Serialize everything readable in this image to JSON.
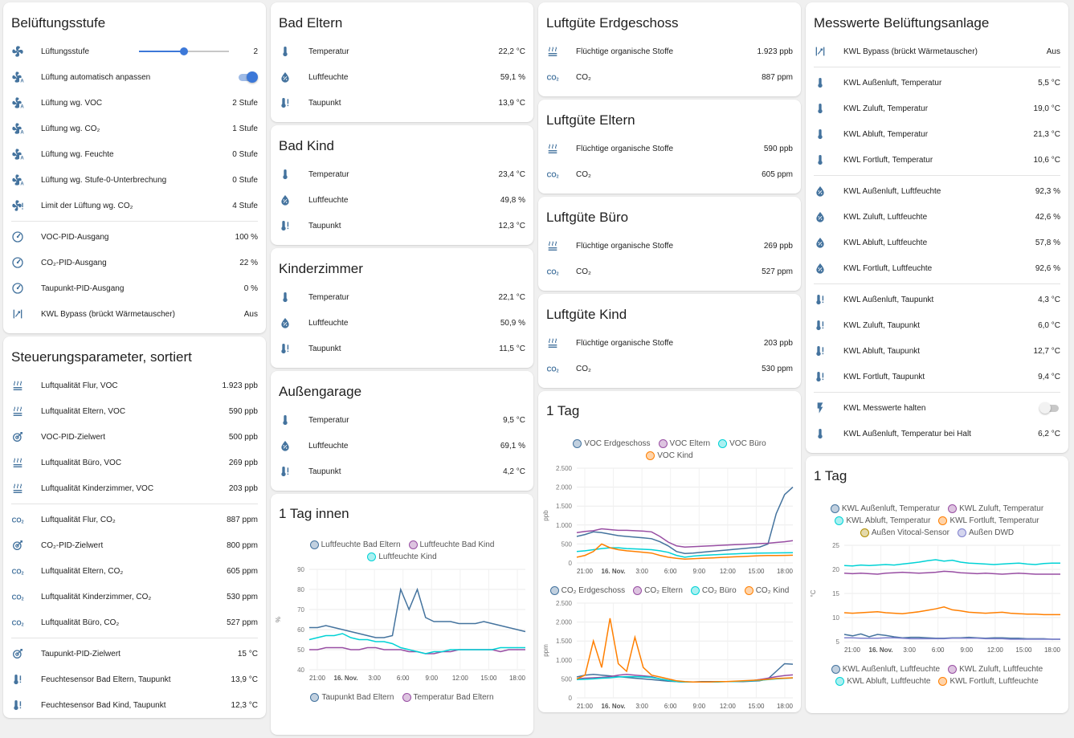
{
  "col1": {
    "card1": {
      "title": "Belüftungsstufe",
      "slider_row": {
        "label": "Lüftungsstufe",
        "value": "2",
        "level_fraction": 0.5
      },
      "rows": [
        {
          "icon": "fan-auto-icon",
          "label": "Lüftung automatisch anpassen",
          "type": "toggle",
          "on": true
        },
        {
          "icon": "fan-auto-icon",
          "label": "Lüftung wg. VOC",
          "value": "2 Stufe"
        },
        {
          "icon": "fan-auto-icon",
          "label": "Lüftung wg. CO₂",
          "value": "1 Stufe"
        },
        {
          "icon": "fan-auto-icon",
          "label": "Lüftung wg. Feuchte",
          "value": "0 Stufe"
        },
        {
          "icon": "fan-auto-icon",
          "label": "Lüftung wg. Stufe-0-Unterbrechung",
          "value": "0 Stufe"
        },
        {
          "icon": "fan-alert-icon",
          "label": "Limit der Lüftung wg. CO₂",
          "value": "4 Stufe"
        }
      ],
      "rows2": [
        {
          "icon": "gauge-icon",
          "label": "VOC-PID-Ausgang",
          "value": "100 %"
        },
        {
          "icon": "gauge-icon",
          "label": "CO₂-PID-Ausgang",
          "value": "22 %"
        },
        {
          "icon": "gauge-icon",
          "label": "Taupunkt-PID-Ausgang",
          "value": "0 %"
        },
        {
          "icon": "bypass-icon",
          "label": "KWL Bypass (brückt Wärmetauscher)",
          "value": "Aus"
        }
      ]
    },
    "card2": {
      "title": "Steuerungsparameter, sortiert",
      "groups": [
        [
          {
            "icon": "air-quality-icon",
            "label": "Luftqualität Flur, VOC",
            "value": "1.923 ppb"
          },
          {
            "icon": "air-quality-icon",
            "label": "Luftqualität Eltern, VOC",
            "value": "590 ppb"
          },
          {
            "icon": "target-icon",
            "label": "VOC-PID-Zielwert",
            "value": "500 ppb"
          },
          {
            "icon": "air-quality-icon",
            "label": "Luftqualität Büro, VOC",
            "value": "269 ppb"
          },
          {
            "icon": "air-quality-icon",
            "label": "Luftqualität Kinderzimmer, VOC",
            "value": "203 ppb"
          }
        ],
        [
          {
            "icon": "co2-icon",
            "label": "Luftqualität Flur, CO₂",
            "value": "887 ppm"
          },
          {
            "icon": "target-icon",
            "label": "CO₂-PID-Zielwert",
            "value": "800 ppm"
          },
          {
            "icon": "co2-icon",
            "label": "Luftqualität Eltern, CO₂",
            "value": "605 ppm"
          },
          {
            "icon": "co2-icon",
            "label": "Luftqualität Kinderzimmer, CO₂",
            "value": "530 ppm"
          },
          {
            "icon": "co2-icon",
            "label": "Luftqualität Büro, CO₂",
            "value": "527 ppm"
          }
        ],
        [
          {
            "icon": "target-icon",
            "label": "Taupunkt-PID-Zielwert",
            "value": "15 °C"
          },
          {
            "icon": "dewpoint-icon",
            "label": "Feuchtesensor Bad Eltern, Taupunkt",
            "value": "13,9 °C"
          },
          {
            "icon": "dewpoint-icon",
            "label": "Feuchtesensor Bad Kind, Taupunkt",
            "value": "12,3 °C"
          }
        ]
      ]
    }
  },
  "col2": {
    "rooms": [
      {
        "title": "Bad Eltern",
        "temp": "22,2 °C",
        "hum": "59,1 %",
        "dew": "13,9 °C"
      },
      {
        "title": "Bad Kind",
        "temp": "23,4 °C",
        "hum": "49,8 %",
        "dew": "12,3 °C"
      },
      {
        "title": "Kinderzimmer",
        "temp": "22,1 °C",
        "hum": "50,9 %",
        "dew": "11,5 °C"
      },
      {
        "title": "Außengarage",
        "temp": "9,5 °C",
        "hum": "69,1 %",
        "dew": "4,2 °C"
      }
    ],
    "labels": {
      "temp": "Temperatur",
      "hum": "Luftfeuchte",
      "dew": "Taupunkt"
    },
    "chart_card": {
      "title": "1 Tag innen",
      "legend1": [
        "Luftfeuchte Bad Eltern",
        "Luftfeuchte Bad Kind",
        "Luftfeuchte Kind"
      ],
      "legend2": [
        "Taupunkt Bad Eltern",
        "Temperatur Bad Eltern"
      ]
    }
  },
  "col3": {
    "cards": [
      {
        "title": "Luftgüte Erdgeschoss",
        "voc": "1.923 ppb",
        "co2": "887 ppm"
      },
      {
        "title": "Luftgüte Eltern",
        "voc": "590 ppb",
        "co2": "605 ppm"
      },
      {
        "title": "Luftgüte Büro",
        "voc": "269 ppb",
        "co2": "527 ppm"
      },
      {
        "title": "Luftgüte Kind",
        "voc": "203 ppb",
        "co2": "530 ppm"
      }
    ],
    "labels": {
      "voc": "Flüchtige organische Stoffe",
      "co2": "CO₂"
    },
    "chart_card": {
      "title": "1 Tag",
      "legend1": [
        "VOC Erdgeschoss",
        "VOC Eltern",
        "VOC Büro",
        "VOC Kind"
      ],
      "legend2": [
        "CO₂ Erdgeschoss",
        "CO₂ Eltern",
        "CO₂ Büro",
        "CO₂ Kind"
      ]
    }
  },
  "col4": {
    "card": {
      "title": "Messwerte Belüftungsanlage",
      "groups": [
        [
          {
            "icon": "bypass-icon",
            "label": "KWL Bypass (brückt Wärmetauscher)",
            "value": "Aus"
          }
        ],
        [
          {
            "icon": "thermometer-icon",
            "label": "KWL Außenluft, Temperatur",
            "value": "5,5 °C"
          },
          {
            "icon": "thermometer-icon",
            "label": "KWL Zuluft, Temperatur",
            "value": "19,0 °C"
          },
          {
            "icon": "thermometer-icon",
            "label": "KWL Abluft, Temperatur",
            "value": "21,3 °C"
          },
          {
            "icon": "thermometer-icon",
            "label": "KWL Fortluft, Temperatur",
            "value": "10,6 °C"
          }
        ],
        [
          {
            "icon": "water-percent-icon",
            "label": "KWL Außenluft, Luftfeuchte",
            "value": "92,3 %"
          },
          {
            "icon": "water-percent-icon",
            "label": "KWL Zuluft, Luftfeuchte",
            "value": "42,6 %"
          },
          {
            "icon": "water-percent-icon",
            "label": "KWL Abluft, Luftfeuchte",
            "value": "57,8 %"
          },
          {
            "icon": "water-percent-icon",
            "label": "KWL Fortluft, Luftfeuchte",
            "value": "92,6 %"
          }
        ],
        [
          {
            "icon": "dewpoint-icon",
            "label": "KWL Außenluft, Taupunkt",
            "value": "4,3 °C"
          },
          {
            "icon": "dewpoint-icon",
            "label": "KWL Zuluft, Taupunkt",
            "value": "6,0 °C"
          },
          {
            "icon": "dewpoint-icon",
            "label": "KWL Abluft, Taupunkt",
            "value": "12,7 °C"
          },
          {
            "icon": "dewpoint-icon",
            "label": "KWL Fortluft, Taupunkt",
            "value": "9,4 °C"
          }
        ],
        [
          {
            "icon": "flash-icon",
            "label": "KWL Messwerte halten",
            "type": "toggle",
            "on": false
          },
          {
            "icon": "thermometer-icon",
            "label": "KWL Außenluft, Temperatur bei Halt",
            "value": "6,2 °C"
          }
        ]
      ]
    },
    "chart_card": {
      "title": "1 Tag",
      "legend1": [
        "KWL Außenluft, Temperatur",
        "KWL Zuluft, Temperatur",
        "KWL Abluft, Temperatur",
        "KWL Fortluft, Temperatur",
        "Außen Vitocal-Sensor",
        "Außen DWD"
      ],
      "legend2": [
        "KWL Außenluft, Luftfeuchte",
        "KWL Zuluft, Luftfeuchte",
        "KWL Abluft, Luftfeuchte",
        "KWL Fortluft, Luftfeuchte"
      ]
    }
  },
  "colors": {
    "blue": "#44739e",
    "purple": "#984ea3",
    "cyan": "#00d2d5",
    "orange": "#ff7f00",
    "olive": "#af8d00",
    "lavender": "#7f80cd",
    "accent": "#3c78d8"
  },
  "chart_data": [
    {
      "type": "line",
      "x_ticks": [
        "21:00",
        "16. Nov.",
        "3:00",
        "6:00",
        "9:00",
        "12:00",
        "15:00",
        "18:00"
      ],
      "ylabel": "%",
      "ylim": [
        40,
        90
      ],
      "y_ticks": [
        "40",
        "50",
        "60",
        "70",
        "80",
        "90"
      ],
      "series": [
        {
          "name": "Luftfeuchte Bad Eltern",
          "color": "#44739e",
          "values": [
            61,
            61,
            62,
            61,
            60,
            59,
            58,
            57,
            56,
            56,
            57,
            80,
            70,
            80,
            66,
            64,
            64,
            64,
            63,
            63,
            63,
            64,
            63,
            62,
            61,
            60,
            59
          ]
        },
        {
          "name": "Luftfeuchte Bad Kind",
          "color": "#984ea3",
          "values": [
            50,
            50,
            51,
            51,
            51,
            50,
            50,
            51,
            51,
            50,
            50,
            50,
            49,
            49,
            48,
            48,
            49,
            49,
            50,
            50,
            50,
            50,
            50,
            49,
            50,
            50,
            50
          ]
        },
        {
          "name": "Luftfeuchte Kind",
          "color": "#00d2d5",
          "values": [
            55,
            56,
            57,
            57,
            58,
            56,
            55,
            55,
            54,
            54,
            53,
            51,
            50,
            49,
            48,
            49,
            49,
            50,
            50,
            50,
            50,
            50,
            50,
            51,
            51,
            51,
            51
          ]
        }
      ]
    },
    {
      "type": "line",
      "x_ticks": [
        "21:00",
        "16. Nov.",
        "3:00",
        "6:00",
        "9:00",
        "12:00",
        "15:00",
        "18:00"
      ],
      "ylabel": "ppb",
      "ylim": [
        0,
        2500
      ],
      "y_ticks": [
        "0",
        "500",
        "1.000",
        "1.500",
        "2.000",
        "2.500"
      ],
      "series": [
        {
          "name": "VOC Erdgeschoss",
          "color": "#44739e",
          "values": [
            700,
            750,
            820,
            800,
            760,
            720,
            700,
            680,
            660,
            640,
            560,
            450,
            300,
            250,
            260,
            280,
            300,
            320,
            340,
            360,
            380,
            400,
            420,
            500,
            1300,
            1800,
            2000
          ]
        },
        {
          "name": "VOC Eltern",
          "color": "#984ea3",
          "values": [
            800,
            830,
            850,
            900,
            880,
            860,
            860,
            850,
            840,
            820,
            700,
            550,
            450,
            420,
            430,
            440,
            450,
            460,
            470,
            480,
            490,
            500,
            510,
            520,
            540,
            560,
            590
          ]
        },
        {
          "name": "VOC Büro",
          "color": "#00d2d5",
          "values": [
            300,
            320,
            350,
            380,
            400,
            400,
            380,
            370,
            360,
            350,
            320,
            280,
            200,
            150,
            180,
            200,
            210,
            220,
            230,
            240,
            250,
            255,
            260,
            262,
            265,
            268,
            269
          ]
        },
        {
          "name": "VOC Kind",
          "color": "#ff7f00",
          "values": [
            150,
            200,
            300,
            500,
            400,
            350,
            320,
            300,
            280,
            260,
            200,
            150,
            120,
            100,
            110,
            120,
            130,
            140,
            150,
            160,
            170,
            180,
            190,
            195,
            198,
            200,
            203
          ]
        }
      ]
    },
    {
      "type": "line",
      "x_ticks": [
        "21:00",
        "16. Nov.",
        "3:00",
        "6:00",
        "9:00",
        "12:00",
        "15:00",
        "18:00"
      ],
      "ylabel": "ppm",
      "ylim": [
        0,
        2500
      ],
      "y_ticks": [
        "0",
        "500",
        "1.000",
        "1.500",
        "2.000",
        "2.500"
      ],
      "series": [
        {
          "name": "CO₂ Erdgeschoss",
          "color": "#44739e",
          "values": [
            550,
            600,
            620,
            600,
            580,
            560,
            540,
            520,
            500,
            480,
            460,
            440,
            430,
            420,
            420,
            430,
            430,
            430,
            430,
            430,
            430,
            440,
            450,
            500,
            700,
            900,
            887
          ]
        },
        {
          "name": "CO₂ Eltern",
          "color": "#984ea3",
          "values": [
            500,
            520,
            530,
            540,
            560,
            600,
            620,
            600,
            580,
            560,
            500,
            460,
            430,
            420,
            420,
            420,
            420,
            430,
            430,
            430,
            440,
            450,
            480,
            520,
            560,
            590,
            605
          ]
        },
        {
          "name": "CO₂ Büro",
          "color": "#00d2d5",
          "values": [
            480,
            490,
            500,
            520,
            530,
            550,
            560,
            560,
            550,
            540,
            500,
            460,
            430,
            420,
            420,
            420,
            420,
            420,
            430,
            430,
            440,
            450,
            460,
            480,
            500,
            515,
            527
          ]
        },
        {
          "name": "CO₂ Kind",
          "color": "#ff7f00",
          "values": [
            500,
            600,
            1500,
            800,
            2100,
            900,
            700,
            1600,
            800,
            600,
            550,
            500,
            450,
            430,
            420,
            420,
            420,
            430,
            430,
            440,
            450,
            460,
            470,
            490,
            510,
            520,
            530
          ]
        }
      ]
    },
    {
      "type": "line",
      "x_ticks": [
        "21:00",
        "16. Nov.",
        "3:00",
        "6:00",
        "9:00",
        "12:00",
        "15:00",
        "18:00"
      ],
      "ylabel": "°C",
      "ylim": [
        5,
        25
      ],
      "y_ticks": [
        "5",
        "10",
        "15",
        "20",
        "25"
      ],
      "series": [
        {
          "name": "KWL Außenluft, Temperatur",
          "color": "#44739e",
          "values": [
            6.5,
            6.2,
            6.6,
            6.0,
            6.5,
            6.3,
            6.0,
            5.8,
            5.9,
            5.9,
            5.8,
            5.7,
            5.7,
            5.8,
            5.8,
            5.9,
            5.8,
            5.7,
            5.8,
            5.8,
            5.7,
            5.7,
            5.6,
            5.6,
            5.6,
            5.5,
            5.5
          ]
        },
        {
          "name": "KWL Zuluft, Temperatur",
          "color": "#984ea3",
          "values": [
            19.2,
            19.1,
            19.2,
            19.1,
            19.0,
            19.2,
            19.3,
            19.4,
            19.3,
            19.2,
            19.3,
            19.4,
            19.6,
            19.5,
            19.3,
            19.2,
            19.1,
            19.2,
            19.1,
            19.0,
            19.1,
            19.2,
            19.1,
            19.0,
            19.0,
            19.0,
            19.0
          ]
        },
        {
          "name": "KWL Abluft, Temperatur",
          "color": "#00d2d5",
          "values": [
            20.8,
            20.7,
            20.9,
            20.8,
            20.9,
            21.0,
            20.9,
            21.1,
            21.3,
            21.5,
            21.8,
            22.0,
            21.7,
            21.9,
            21.5,
            21.3,
            21.2,
            21.1,
            21.0,
            21.1,
            21.2,
            21.3,
            21.1,
            21.0,
            21.2,
            21.3,
            21.3
          ]
        },
        {
          "name": "KWL Fortluft, Temperatur",
          "color": "#ff7f00",
          "values": [
            11.0,
            10.9,
            11.0,
            11.1,
            11.2,
            11.0,
            10.9,
            10.8,
            11.0,
            11.2,
            11.5,
            11.8,
            12.2,
            11.6,
            11.4,
            11.1,
            11.0,
            10.9,
            11.0,
            11.1,
            10.9,
            10.8,
            10.7,
            10.7,
            10.6,
            10.6,
            10.6
          ]
        },
        {
          "name": "Außen Vitocal-Sensor",
          "color": "#af8d00",
          "values": []
        },
        {
          "name": "Außen DWD",
          "color": "#7f80cd",
          "values": [
            5.8,
            5.8,
            5.7,
            5.7,
            5.7,
            5.8,
            5.8,
            5.7,
            5.6,
            5.6,
            5.6,
            5.6,
            5.6,
            5.7,
            5.7,
            5.7,
            5.7,
            5.6,
            5.6,
            5.6,
            5.5,
            5.5,
            5.5,
            5.5,
            5.5,
            5.5,
            5.5
          ]
        }
      ]
    }
  ]
}
